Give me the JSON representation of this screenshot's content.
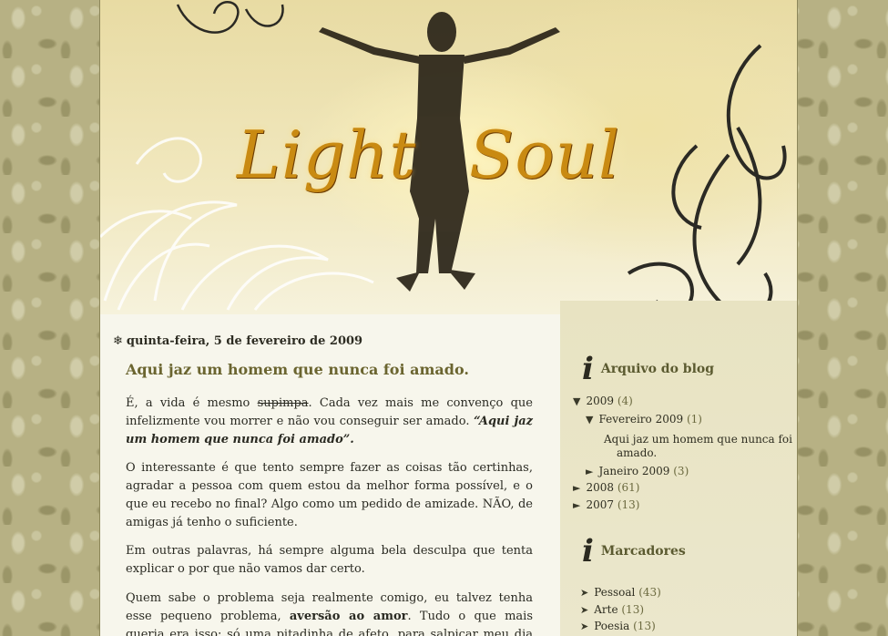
{
  "header": {
    "title_word_1": "Light",
    "title_word_2": "Soul"
  },
  "post": {
    "date": "quinta-feira, 5 de fevereiro de 2009",
    "title": "Aqui jaz um homem que nunca foi amado.",
    "p1_a": "É, a vida é mesmo ",
    "p1_strike": "supimpa",
    "p1_b": ". Cada vez mais me convenço que infelizmente vou morrer e não vou conseguir ser amado. ",
    "p1_quote": "“Aqui jaz um homem que nunca foi amado”",
    "p1_end": ".",
    "p2": "O interessante é que tento sempre fazer as coisas tão certinhas, agradar a pessoa com quem estou da melhor forma possível, e o que eu recebo no final? Algo como um pedido de amizade. NÃO, de amigas já tenho o suficiente.",
    "p3": "Em outras palavras, há sempre alguma bela desculpa que tenta explicar o por que não vamos dar certo.",
    "p4_a": "Quem sabe o problema seja realmente comigo, eu talvez tenha esse pequeno problema, ",
    "p4_bold": "aversão ao amor",
    "p4_b": ". Tudo o que mais queria era isso: só uma pitadinha de afeto, para salpicar meu dia com momentos"
  },
  "sidebar": {
    "icon_glyph": "i",
    "archive": {
      "title": "Arquivo do blog",
      "y2009": {
        "label": "2009",
        "count": "(4)"
      },
      "feb2009": {
        "label": "Fevereiro 2009",
        "count": "(1)"
      },
      "post_link": "Aqui jaz um homem que nunca foi",
      "post_link_2": "amado.",
      "jan2009": {
        "label": "Janeiro 2009",
        "count": "(3)"
      },
      "y2008": {
        "label": "2008",
        "count": "(61)"
      },
      "y2007": {
        "label": "2007",
        "count": "(13)"
      }
    },
    "labels": {
      "title": "Marcadores",
      "items": [
        {
          "label": "Pessoal",
          "count": "(43)"
        },
        {
          "label": "Arte",
          "count": "(13)"
        },
        {
          "label": "Poesia",
          "count": "(13)"
        }
      ]
    }
  },
  "colors": {
    "background_pattern": "#b7b184",
    "page_bg": "#f7f6ec",
    "sidebar_bg": "#e8e3c2",
    "title_gold": "#c98a12",
    "post_title": "#6b6530"
  }
}
